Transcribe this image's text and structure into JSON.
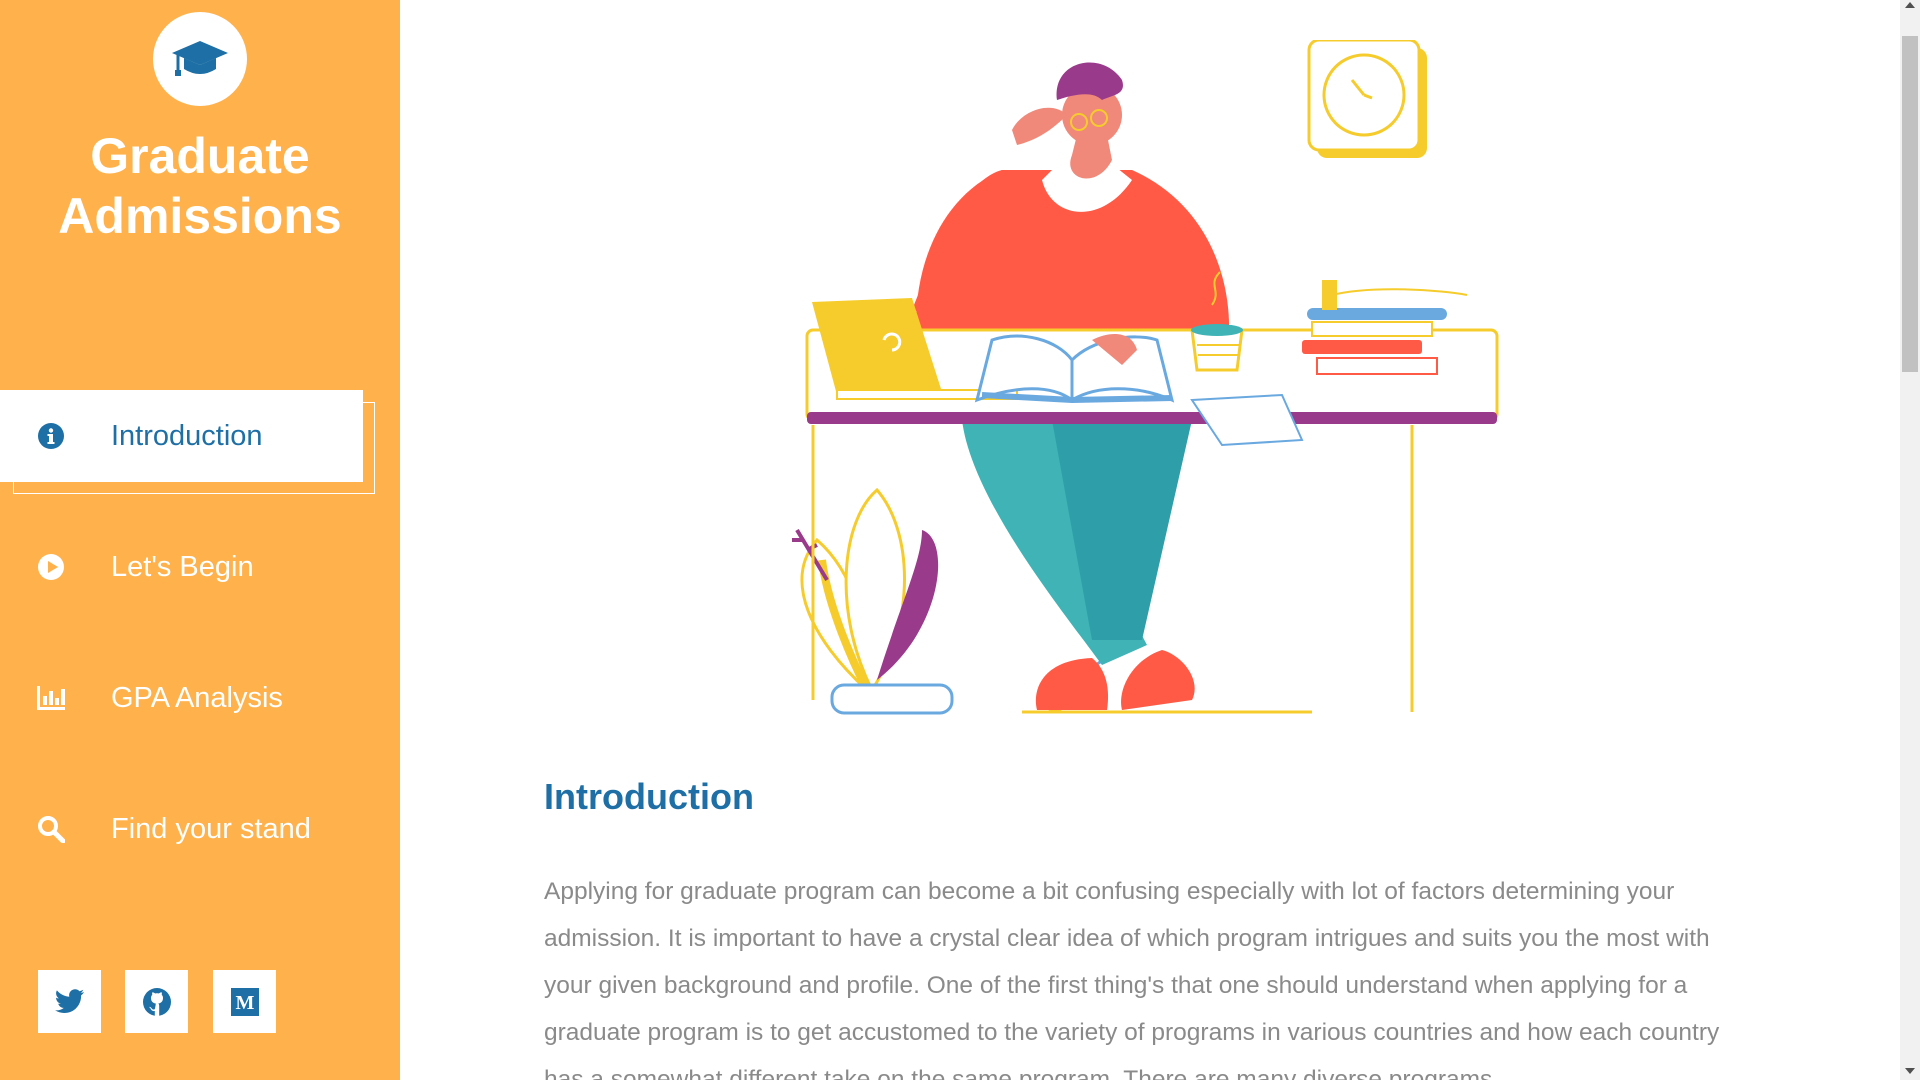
{
  "sidebar": {
    "brand_line1": "Graduate",
    "brand_line2": "Admissions",
    "logo_icon": "graduation-cap-icon",
    "nav": [
      {
        "label": "Introduction",
        "icon": "info-circle-icon",
        "active": true
      },
      {
        "label": "Let's Begin",
        "icon": "play-circle-icon",
        "active": false
      },
      {
        "label": "GPA Analysis",
        "icon": "bar-chart-icon",
        "active": false
      },
      {
        "label": "Find your stand",
        "icon": "search-icon",
        "active": false
      }
    ],
    "social": [
      {
        "icon": "twitter-icon"
      },
      {
        "icon": "github-icon"
      },
      {
        "icon": "medium-icon",
        "glyph": "M"
      }
    ]
  },
  "main": {
    "hero_illustration": "student-at-desk-illustration",
    "section_title": "Introduction",
    "body_text": "Applying for graduate program can become a bit confusing especially with lot of factors determining your admission. It is important to have a crystal clear idea of which program intrigues and suits you the most with your given background and profile. One of the first thing's that one should understand when applying for a graduate program is to get accustomed to the variety of programs in various countries and how each country has a somewhat different take on the same program. There are many diverse programs"
  },
  "colors": {
    "sidebar_bg": "#ffb24c",
    "accent_blue": "#1d6fa5",
    "body_text": "#8a8a8a",
    "white": "#ffffff"
  }
}
